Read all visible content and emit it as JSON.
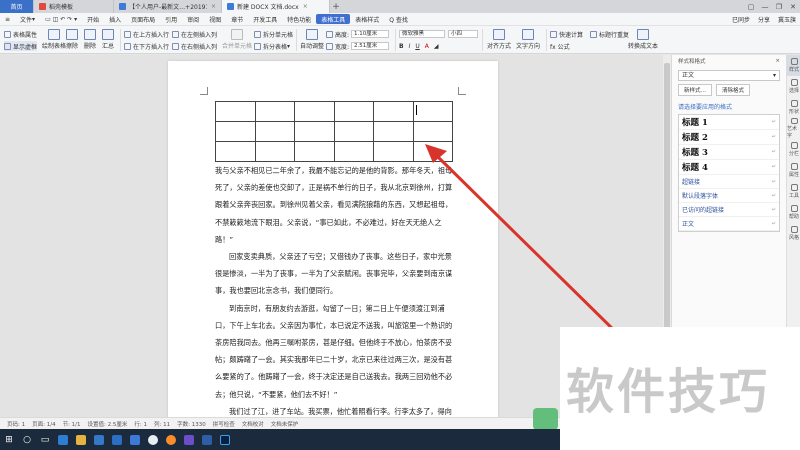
{
  "tabs": [
    {
      "label": "首页",
      "color": "#3a70c8"
    },
    {
      "label": "稻壳模板",
      "color": "#e2483e"
    },
    {
      "label": "【个人用户-最新文…+20191212",
      "color": "#3f7ad6"
    },
    {
      "label": "新建 DOCX 文档.docx",
      "color": "#3f7ad6"
    }
  ],
  "tab_close": "×",
  "tab_add": "+",
  "menu": {
    "file": "文件",
    "items": [
      "开始",
      "插入",
      "页面布局",
      "引用",
      "审阅",
      "视图",
      "章节",
      "开发工具",
      "特色功能"
    ],
    "active": "表格工具",
    "table_style": "表格样式",
    "search": "Q 查找",
    "sync": "已同步",
    "share": "分享",
    "user": "冀玉旗"
  },
  "ribbon": {
    "table_props": "表格属性",
    "show_grid": "显示虚框",
    "draw_table": "绘制表格",
    "erase": "擦除",
    "delete": "删除",
    "summary": "汇总",
    "insert_above": "在上方插入行",
    "insert_below": "在下方插入行",
    "insert_left": "在左侧插入列",
    "insert_right": "在右侧插入列",
    "merge_cells": "合并单元格",
    "split_cells": "拆分单元格",
    "split_table": "拆分表格",
    "autofit": "自动调整",
    "height_label": "高度:",
    "height_value": "1.10厘米",
    "width_label": "宽度:",
    "width_value": "2.51厘米",
    "font_name": "微软雅黑",
    "font_size": "小四",
    "align": "对齐方式",
    "text_dir": "文字方向",
    "quick_calc": "快速计算",
    "repeat_header": "标题行重复",
    "fx": "fx 公式",
    "to_text": "转换成文本",
    "select": "选择"
  },
  "document": {
    "table": {
      "rows": 3,
      "cols": 6
    },
    "paragraphs": [
      {
        "indent": false,
        "text": "我与父亲不相见已二年余了，我最不能忘记的是他的背影。那年冬天，祖母死了，父亲的差使也交卸了，正是祸不单行的日子，我从北京到徐州，打算跟着父亲奔丧回家。到徐州见着父亲，看见满院狼藉的东西，又想起祖母，不禁簌簌地流下眼泪。父亲说，“事已如此，不必难过，好在天无绝人之路！”"
      },
      {
        "indent": true,
        "text": "回家变卖典质，父亲还了亏空；又借钱办了丧事。这些日子，家中光景很是惨淡，一半为了丧事，一半为了父亲赋闲。丧事完毕，父亲要到南京谋事，我也要回北京念书，我们便同行。"
      },
      {
        "indent": true,
        "text": "到南京时，有朋友约去游逛，勾留了一日；第二日上午便须渡江到浦口，下午上车北去。父亲因为事忙，本已说定不送我，叫旅馆里一个熟识的茶房陪我同去。他再三嘱咐茶房，甚是仔细。但他终于不放心，怕茶房不妥帖；颇踌躇了一会。其实我那年已二十岁，北京已来往过两三次，是没有甚么要紧的了。他踌躇了一会，终于决定还是自己送我去。我两三回劝他不必去；他只说，“不要紧，他们去不好！”"
      },
      {
        "indent": true,
        "text": "我们过了江，进了车站。我买票，他忙着照看行李。行李太多了，得向脚夫行些小费，才可过去。他便又忙着和他们讲价钱。我那时真是聪明过分，总觉他"
      }
    ]
  },
  "style_pane": {
    "title": "样式和格式",
    "close": "×",
    "current": "正文",
    "new_style": "新样式…",
    "clear_format": "清除格式",
    "apply_label": "请选择要应用的格式",
    "styles": [
      {
        "name": "标题 1",
        "heading": true
      },
      {
        "name": "标题 2",
        "heading": true
      },
      {
        "name": "标题 3",
        "heading": true
      },
      {
        "name": "标题 4",
        "heading": true
      },
      {
        "name": "超链接",
        "heading": false
      },
      {
        "name": "默认段落字体",
        "heading": false
      },
      {
        "name": "已访问的超链接",
        "heading": false
      },
      {
        "name": "正文",
        "heading": false
      }
    ],
    "mark": "↵"
  },
  "right_toolbar": [
    "样式",
    "选择",
    "形状",
    "艺术字",
    "分栏",
    "属性",
    "工具",
    "帮助",
    "风格"
  ],
  "status": {
    "page": "页码: 1",
    "pages": "页面: 1/4",
    "section": "节: 1/1",
    "line": "设置值: 2.5厘米",
    "row": "行: 1",
    "col": "列: 11",
    "words": "字数: 1330",
    "spell": "拼写检查",
    "check": "文档校对",
    "encrypt": "文档未保护"
  },
  "watermark": "软件技巧",
  "colors": {
    "accent": "#3f6fcf",
    "arrow": "#d9342b",
    "taskbar": "#1b2a3c"
  }
}
